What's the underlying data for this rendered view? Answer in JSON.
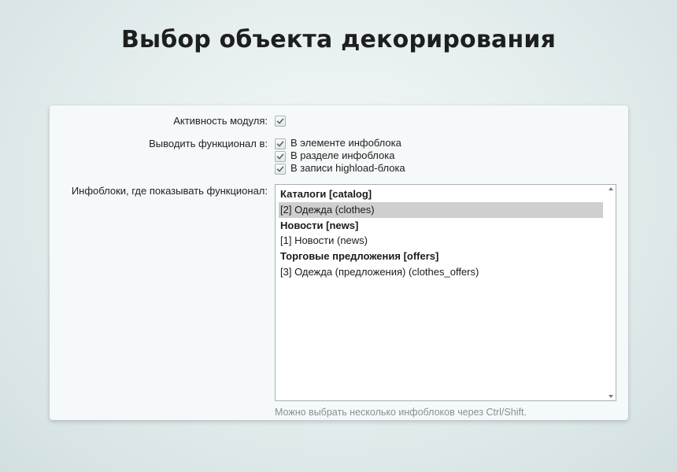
{
  "page": {
    "title": "Выбор объекта декорирования"
  },
  "form": {
    "module_active": {
      "label": "Активность модуля:",
      "checked": true
    },
    "output_in": {
      "label": "Выводить функционал в:",
      "options": [
        {
          "label": "В элементе инфоблока",
          "checked": true
        },
        {
          "label": "В разделе инфоблока",
          "checked": true
        },
        {
          "label": "В записи highload-блока",
          "checked": true
        }
      ]
    },
    "iblocks": {
      "label": "Инфоблоки, где показывать функционал:",
      "items": [
        {
          "text": "Каталоги [catalog]",
          "kind": "group",
          "selected": false
        },
        {
          "text": "[2] Одежда (clothes)",
          "kind": "option",
          "selected": true
        },
        {
          "text": "Новости [news]",
          "kind": "group",
          "selected": false
        },
        {
          "text": "[1] Новости (news)",
          "kind": "option",
          "selected": false
        },
        {
          "text": "Торговые предложения [offers]",
          "kind": "group",
          "selected": false
        },
        {
          "text": "[3] Одежда (предложения) (clothes_offers)",
          "kind": "option",
          "selected": false
        }
      ],
      "hint": "Можно выбрать несколько инфоблоков через Ctrl/Shift."
    }
  },
  "colors": {
    "selected_row": "#cfcfcf",
    "hint_text": "#8a8f91"
  }
}
